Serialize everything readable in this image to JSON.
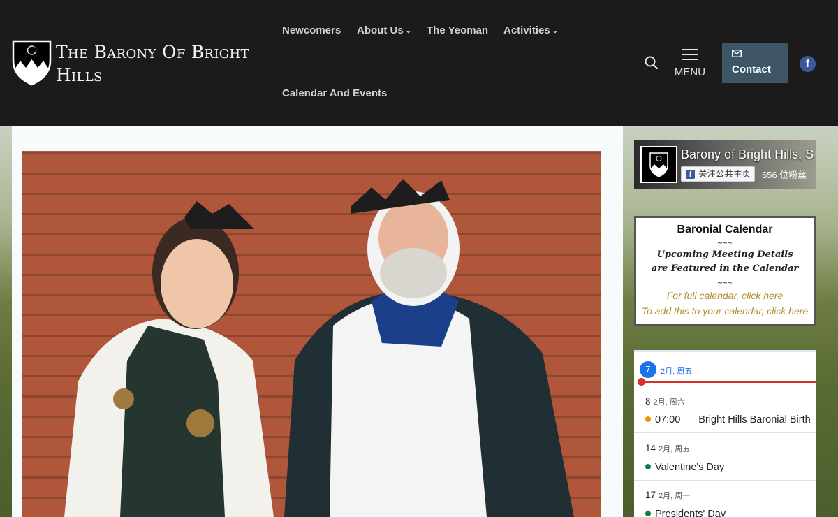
{
  "site": {
    "title": "The Barony Of Bright Hills"
  },
  "nav": {
    "items": [
      {
        "label": "Newcomers",
        "has_dropdown": false
      },
      {
        "label": "About Us",
        "has_dropdown": true
      },
      {
        "label": "The Yeoman",
        "has_dropdown": false
      },
      {
        "label": "Activities",
        "has_dropdown": true
      },
      {
        "label": "Calendar And Events",
        "has_dropdown": false
      }
    ],
    "menu_label": "MENU",
    "contact_label": "Contact",
    "facebook_glyph": "f"
  },
  "facebook_widget": {
    "page_name": "Barony of Bright Hills, S",
    "follow_label": "关注公共主页",
    "fans": "656 位粉丝"
  },
  "baronial_calendar": {
    "title": "Baronial Calendar",
    "separator": "~~~",
    "note_line1": "Upcoming Meeting Details",
    "note_line2": "are Featured in the Calendar",
    "full_calendar_link": "For full calendar, click here",
    "add_calendar_link": "To add this to your calendar, click here"
  },
  "agenda": {
    "today": {
      "day": "7",
      "label": "2月, 周五"
    },
    "days": [
      {
        "day": "8",
        "label": "2月, 周六",
        "events": [
          {
            "time": "07:00",
            "title": "Bright Hills Baronial Birth",
            "color": "#f09300"
          }
        ]
      },
      {
        "day": "14",
        "label": "2月, 周五",
        "events": [
          {
            "time": "",
            "title": "Valentine's Day",
            "color": "#0b8043"
          }
        ]
      },
      {
        "day": "17",
        "label": "2月, 周一",
        "events": [
          {
            "time": "",
            "title": "Presidents' Day",
            "color": "#0b8043"
          }
        ]
      }
    ]
  },
  "colors": {
    "header_bg": "#1b1b1b",
    "contact_bg": "#3d5564",
    "link_gold": "#b08d2e",
    "today_blue": "#1a73e8",
    "now_red": "#d93025"
  }
}
